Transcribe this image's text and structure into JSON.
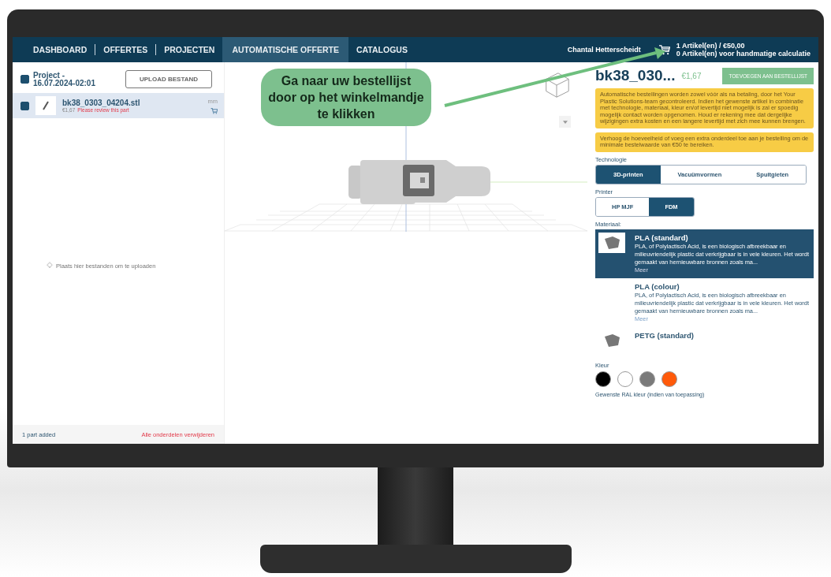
{
  "nav": {
    "tabs": [
      {
        "label": "DASHBOARD",
        "selected": false
      },
      {
        "label": "OFFERTES",
        "selected": false
      },
      {
        "label": "PROJECTEN",
        "selected": false
      },
      {
        "label": "AUTOMATISCHE OFFERTE",
        "selected": true
      },
      {
        "label": "CATALOGUS",
        "selected": false
      }
    ],
    "user": "Chantal Hetterscheidt",
    "cart_line_1": "1 Artikel(en) / €50,00",
    "cart_line_2": "0 Artikel(en) voor handmatige calculatie"
  },
  "sidebar": {
    "project": {
      "label": "Project - 16.07.2024-02:01",
      "checked": true
    },
    "upload_button": "UPLOAD BESTAND",
    "parts": [
      {
        "name": "bk38_0303_04204.stl",
        "price": "€1,67",
        "warning": "Please review this part",
        "unit": "mm",
        "checked": true,
        "selected": true
      }
    ],
    "drop_hint": "Plaats hier bestanden om te uploaden",
    "status": "1 part added",
    "remove_all": "Alle onderdelen verwijderen"
  },
  "callout": "Ga naar uw bestellijst door op het winkelmandje te klikken",
  "details": {
    "title": "bk38_030...",
    "price": "€1,67",
    "add_button": "TOEVOEGEN AAN BESTELLIJST",
    "notices": [
      "Automatische bestellingen worden zowel vóór als na betaling, door het Your Plastic Solutions-team gecontroleerd. Indien het gewenste artikel in combinatie met technologie, materiaal, kleur en/of levertijd niet mogelijk is zal er spoedig mogelijk contact worden opgenomen. Houd er rekening mee dat dergelijke wijzigingen extra kosten en een langere levertijd met zich mee kunnen brengen.",
      "Verhoog de hoeveelheid of voeg een extra onderdeel toe aan je bestelling om de minimale bestelwaarde van €50 te bereiken."
    ],
    "technology": {
      "label": "Technologie",
      "options": [
        {
          "label": "3D-printen",
          "selected": true
        },
        {
          "label": "Vacuümvormen",
          "selected": false
        },
        {
          "label": "Spuitgieten",
          "selected": false
        }
      ]
    },
    "printer": {
      "label": "Printer",
      "options": [
        {
          "label": "HP MJF",
          "selected": false
        },
        {
          "label": "FDM",
          "selected": true
        }
      ]
    },
    "material": {
      "label": "Materiaal:",
      "items": [
        {
          "name": "PLA (standard)",
          "description": "PLA, of Polylactisch Acid, is een biologisch afbreekbaar en milieuvriendelijk plastic dat verkrijgbaar is in vele kleuren. Het wordt gemaakt van hernieuwbare bronnen zoals ma...",
          "more": "Meer",
          "selected": true,
          "thumbnail": true
        },
        {
          "name": "PLA (colour)",
          "description": "PLA, of Polylactisch Acid, is een biologisch afbreekbaar en milieuvriendelijk plastic dat verkrijgbaar is in vele kleuren. Het wordt gemaakt van hernieuwbare bronnen zoals ma...",
          "more": "Meer",
          "selected": false,
          "thumbnail": false
        },
        {
          "name": "PETG (standard)",
          "selected": false,
          "thumbnail": true
        }
      ]
    },
    "color": {
      "label": "Kleur",
      "swatches": [
        {
          "color": "#000000"
        },
        {
          "color": "#ffffff"
        },
        {
          "color": "#7a7a7a"
        },
        {
          "color": "#ff5a0a"
        }
      ],
      "ral_label": "Gewenste RAL kleur (indien van toepassing)"
    }
  }
}
